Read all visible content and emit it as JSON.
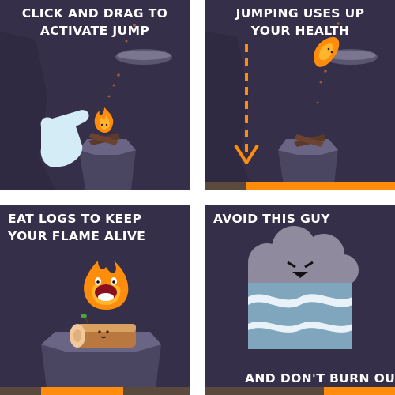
{
  "panels": [
    {
      "caption_line1": "CLICK AND DRAG TO",
      "caption_line2": "ACTIVATE JUMP"
    },
    {
      "caption_line1": "JUMPING USES UP",
      "caption_line2": "YOUR HEALTH"
    },
    {
      "caption_line1": "EAT LOGS TO KEEP",
      "caption_line2": "YOUR FLAME ALIVE"
    },
    {
      "caption_line1": "AVOID THIS GUY",
      "caption_line2": "AND DON'T BURN OUT"
    }
  ],
  "colors": {
    "background": "#362f4a",
    "flame": "#ff8c0a",
    "flame_light": "#ffb52e",
    "rock": "#4a4560",
    "cloud": "#8f8a9e",
    "water": "#7fa6bd",
    "log": "#d9a261",
    "hand": "#d3ecf5"
  },
  "icons": [
    "hand-pointer-icon",
    "fire-icon",
    "log-icon",
    "cloud-enemy-icon",
    "down-arrow-icon"
  ]
}
